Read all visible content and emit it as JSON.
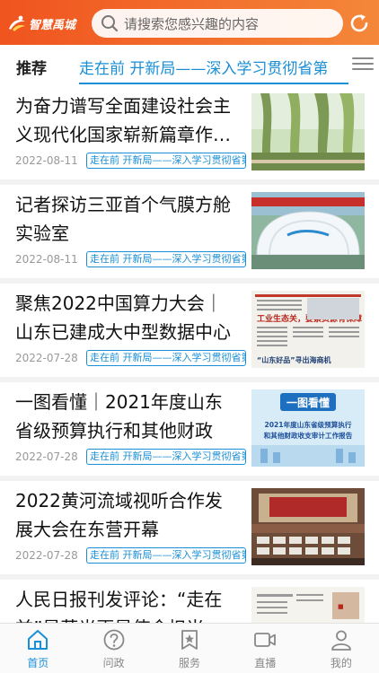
{
  "header": {
    "logo_text": "智慧禹城",
    "search_placeholder": "请搜索您感兴趣的内容"
  },
  "channels": {
    "recommend": "推荐",
    "active": "走在前 开新局——深入学习贯彻省第"
  },
  "news": [
    {
      "title": "为奋力谱写全面建设社会主义现代化国家崭新篇章作…",
      "date": "2022-08-11",
      "tag": "走在前 开新局——深入学习贯彻省第",
      "thumb": "willow-park"
    },
    {
      "title": "记者探访三亚首个气膜方舱实验室",
      "date": "2022-08-11",
      "tag": "走在前 开新局——深入学习贯彻省第",
      "thumb": "air-dome-lab"
    },
    {
      "title": "聚焦2022中国算力大会｜山东已建成大中型数据中心4…",
      "date": "2022-07-28",
      "tag": "走在前 开新局——深入学习贯彻省第",
      "thumb": "newspaper-page",
      "thumb_text": [
        "工业生态关，要素资源有保障",
        "“山东好品”寻出海商机"
      ]
    },
    {
      "title": "一图看懂｜2021年度山东省级预算执行和其他财政收…",
      "date": "2022-07-28",
      "tag": "走在前 开新局——深入学习贯彻省第",
      "thumb": "infographic",
      "thumb_text": [
        "一图看懂",
        "2021年度山东省级预算执行",
        "和其他财政收支审计工作报告"
      ]
    },
    {
      "title": "2022黄河流域视听合作发展大会在东营开幕",
      "date": "2022-07-28",
      "tag": "走在前 开新局——深入学习贯彻省第",
      "thumb": "conference-hall"
    },
    {
      "title": "人民日报刊发评论：“走在前”是芦光更是使命担当",
      "date": "",
      "tag": "",
      "thumb": "newspaper-page-2"
    }
  ],
  "tabs": [
    {
      "label": "首页",
      "icon": "home-icon",
      "active": true
    },
    {
      "label": "问政",
      "icon": "question-icon",
      "active": false
    },
    {
      "label": "服务",
      "icon": "bookmark-star-icon",
      "active": false
    },
    {
      "label": "直播",
      "icon": "video-camera-icon",
      "active": false
    },
    {
      "label": "我的",
      "icon": "user-icon",
      "active": false
    }
  ],
  "colors": {
    "header_start": "#f0541f",
    "header_end": "#f4873a",
    "accent_blue": "#1a8fd6"
  }
}
